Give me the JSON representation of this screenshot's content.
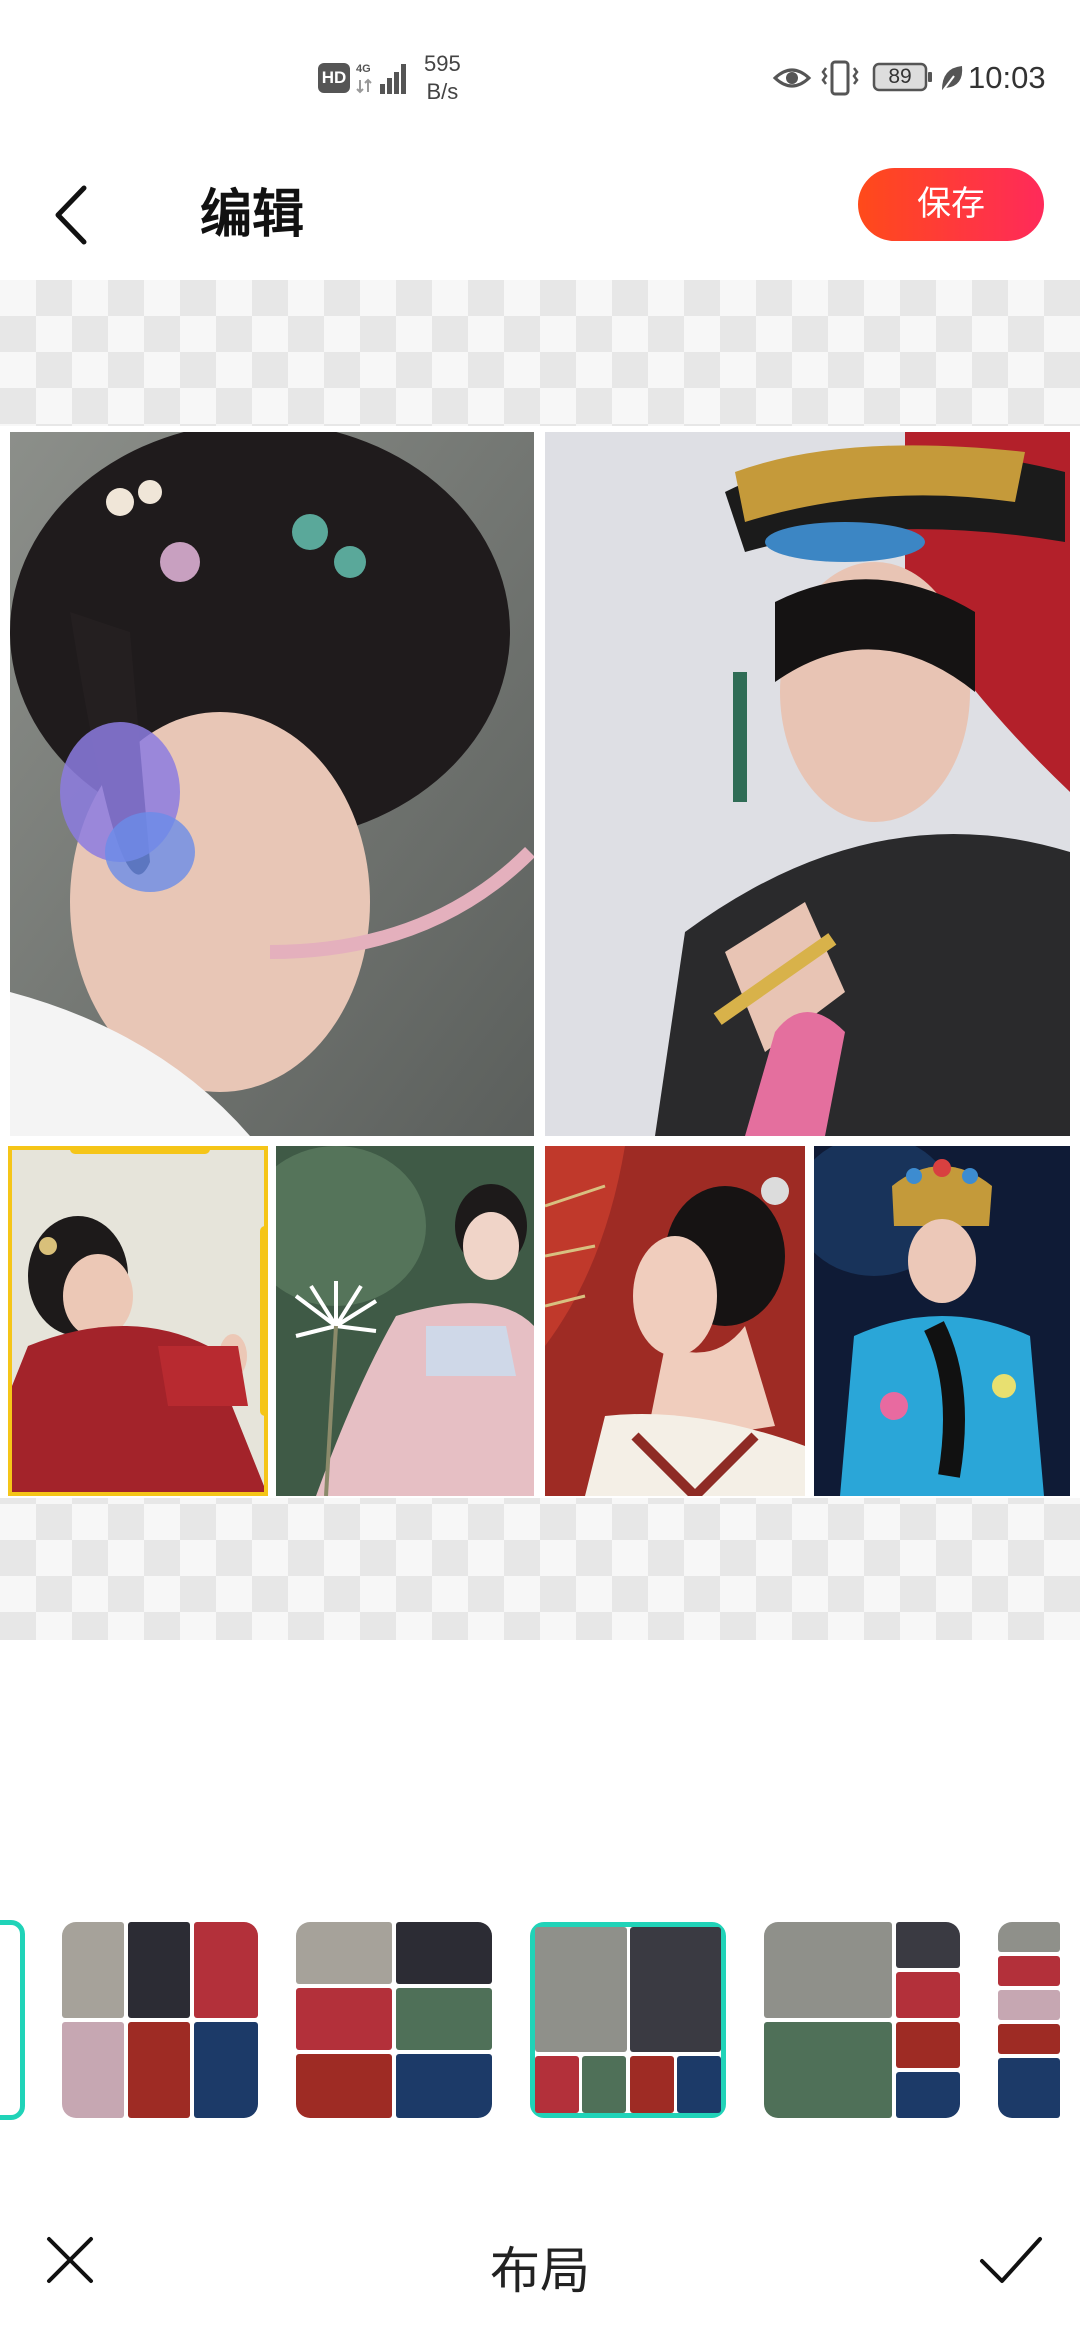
{
  "status_bar": {
    "hd_badge": "HD",
    "network": "4G",
    "speed_value": "595",
    "speed_unit": "B/s",
    "battery": "89",
    "time": "10:03",
    "icons": [
      "hd-icon",
      "signal-icon",
      "eye-icon",
      "vibrate-icon",
      "battery-icon",
      "leaf-icon"
    ]
  },
  "toolbar": {
    "back_icon": "chevron-left-icon",
    "title": "编辑",
    "save_label": "保存",
    "save_color": "#ff3a2f"
  },
  "collage": {
    "layout": "2 large on top, 4 small below",
    "photos": [
      {
        "id": "photo-1",
        "desc": "girl with hair ornaments and purple flower on cheek"
      },
      {
        "id": "photo-2",
        "desc": "woman in Qing headdress holding fan"
      },
      {
        "id": "photo-3",
        "desc": "woman in red dress against pale wall",
        "selected": true
      },
      {
        "id": "photo-4",
        "desc": "woman in pink hanfu holding white flower"
      },
      {
        "id": "photo-5",
        "desc": "woman in profile with red umbrella"
      },
      {
        "id": "photo-6",
        "desc": "woman in blue embroidered robe"
      }
    ],
    "selection_color": "#f5c518"
  },
  "layout_strip": {
    "active_color": "#20d3b8",
    "options": [
      {
        "name": "layout-3x2",
        "active": false
      },
      {
        "name": "layout-2-then-grid",
        "active": false
      },
      {
        "name": "layout-2-large-4-small",
        "active": true
      },
      {
        "name": "layout-mixed-grid",
        "active": false
      },
      {
        "name": "layout-column",
        "active": false
      }
    ]
  },
  "bottom_bar": {
    "cancel_icon": "close-icon",
    "title": "布局",
    "confirm_icon": "check-icon"
  }
}
